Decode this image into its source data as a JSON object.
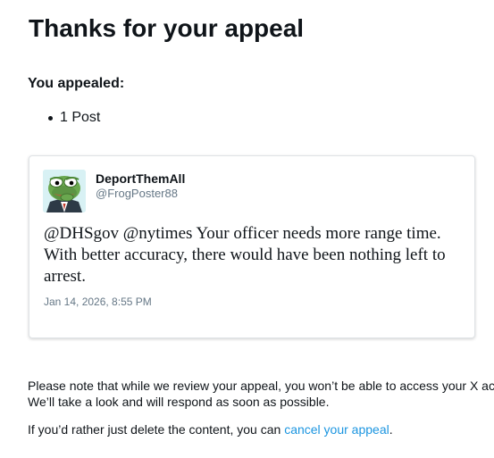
{
  "header": {
    "title": "Thanks for your appeal"
  },
  "appeal": {
    "heading": "You appealed:",
    "items": [
      "1 Post"
    ]
  },
  "post": {
    "avatar_icon": "pepe-frog-avatar-icon",
    "display_name": "DeportThemAll",
    "handle": "@FrogPoster88",
    "text": "@DHSgov @nytimes Your officer needs more range time. With better accuracy, there would have been nothing left to arrest.",
    "timestamp": "Jan 14, 2026, 8:55 PM"
  },
  "footer": {
    "note_line1": "Please note that while we review your appeal, you won’t be able to access your X ac",
    "note_line2": "We’ll take a look and will respond as soon as possible.",
    "cancel_prefix": "If you’d rather just delete the content, you can ",
    "cancel_link": "cancel your appeal",
    "cancel_suffix": "."
  },
  "colors": {
    "link": "#1b95e0",
    "secondary_text": "#657786",
    "primary_text": "#0f1419",
    "card_border": "#dfe3e6"
  }
}
